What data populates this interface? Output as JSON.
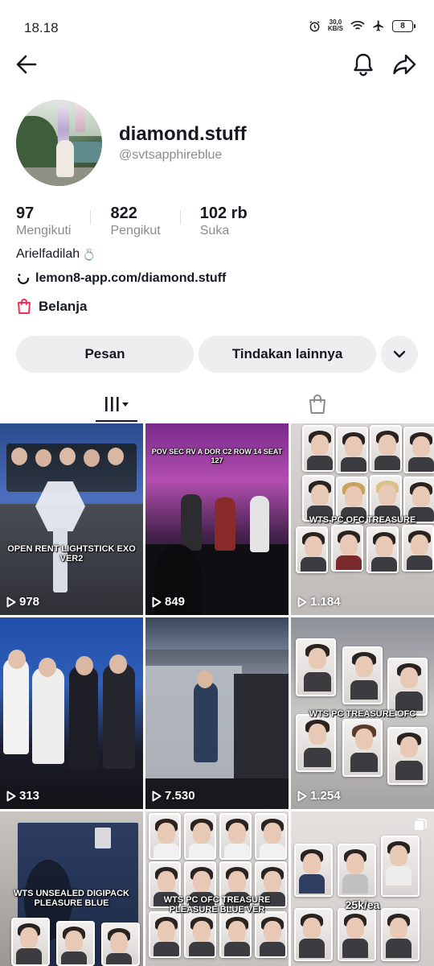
{
  "status_bar": {
    "time": "18.18",
    "net_speed_value": "30,0",
    "net_speed_unit": "KB/S",
    "battery": "8"
  },
  "profile": {
    "username": "diamond.stuff",
    "handle": "@svtsapphireblue",
    "stats": [
      {
        "value": "97",
        "label": "Mengikuti"
      },
      {
        "value": "822",
        "label": "Pengikut"
      },
      {
        "value": "102 rb",
        "label": "Suka"
      }
    ],
    "bio": "Arielfadilah",
    "bio_emoji": "💍",
    "link": "lemon8-app.com/diamond.stuff",
    "shop_label": "Belanja"
  },
  "actions": {
    "message_label": "Pesan",
    "more_actions_label": "Tindakan lainnya"
  },
  "tabs": [
    {
      "icon": "grid-icon",
      "active": true
    },
    {
      "icon": "shopping-bag-icon",
      "active": false
    }
  ],
  "videos": [
    {
      "caption": "OPEN RENT LIGHTSTICK EXO VER2",
      "views": "978"
    },
    {
      "caption": "POV SEC RV A DOR C2 ROW 14 SEAT 127",
      "views": "849"
    },
    {
      "caption": "WTS PC OFC TREASURE",
      "views": "1.184"
    },
    {
      "caption": "",
      "views": "313"
    },
    {
      "caption": "",
      "views": "7.530"
    },
    {
      "caption": "WTS PC TREASURE OFC",
      "views": "1.254"
    },
    {
      "caption": "WTS UNSEALED DIGIPACK PLEASURE BLUE",
      "views": ""
    },
    {
      "caption": "WTS PC OFC TREASURE PLEASURE BLUE VER",
      "views": ""
    },
    {
      "caption": "25k/ea",
      "views": ""
    }
  ],
  "colors": {
    "accent": "#fe2c55",
    "button_bg": "#eeeef0",
    "text_primary": "#161823",
    "text_secondary": "#8a8b91"
  }
}
